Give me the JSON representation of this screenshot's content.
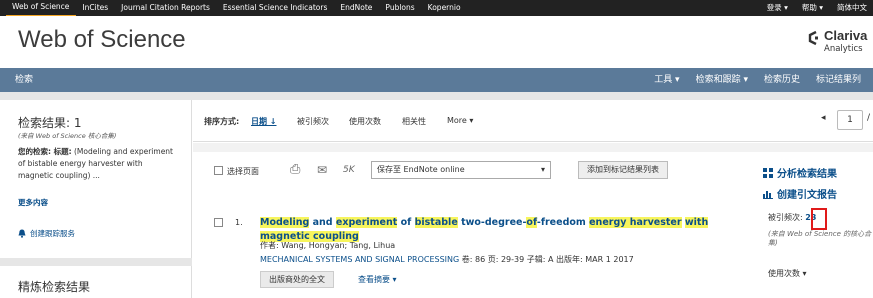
{
  "topnav": {
    "links": [
      "Web of Science",
      "InCites",
      "Journal Citation Reports",
      "Essential Science Indicators",
      "EndNote",
      "Publons",
      "Kopernio"
    ],
    "right": [
      "登录 ▾",
      "帮助 ▾",
      "简体中文"
    ]
  },
  "brand": {
    "title": "Web of Science",
    "company": "Clariva",
    "company_sub": "Analytics"
  },
  "searchbar": {
    "label": "检索",
    "menu": [
      "工具 ▾",
      "检索和跟踪 ▾",
      "检索历史",
      "标记结果列"
    ]
  },
  "left": {
    "results_title": "检索结果: 1",
    "results_source": "(来自 Web of Science 核心合集)",
    "query_label": "您的检索: 标题:",
    "query_text": "(Modeling and experiment of bistable energy harvester with magnetic coupling) ...",
    "more": "更多内容",
    "alert": "创建跟踪服务",
    "refine_title": "精炼检索结果"
  },
  "sort": {
    "label": "排序方式:",
    "options": [
      "日期 ↓",
      "被引频次",
      "使用次数",
      "相关性",
      "More ▾"
    ],
    "page_prev": "◂",
    "page_value": "1",
    "page_next": "/"
  },
  "tools": {
    "select_page": "选择页面",
    "print_icon": "⎙",
    "email_icon": "✉",
    "five_k": "5K",
    "save_option": "保存至 EndNote online",
    "add_marked": "添加到标记结果列表",
    "analyze": "分析检索结果",
    "citation_report": "创建引文报告"
  },
  "record": {
    "index": "1.",
    "title_segments": [
      {
        "text": "Modeling",
        "hl": true
      },
      {
        "text": " and ",
        "hl": false
      },
      {
        "text": "experiment",
        "hl": true
      },
      {
        "text": " of ",
        "hl": false
      },
      {
        "text": "bistable",
        "hl": true
      },
      {
        "text": " two-degree-",
        "hl": false
      },
      {
        "text": "of",
        "hl": true
      },
      {
        "text": "-freedom ",
        "hl": false
      },
      {
        "text": "energy harvester",
        "hl": true
      },
      {
        "text": " ",
        "hl": false
      },
      {
        "text": "with magnetic coupling",
        "hl": true
      }
    ],
    "authors": "作者: Wang, Hongyan; Tang, Lihua",
    "journal": "MECHANICAL SYSTEMS AND SIGNAL PROCESSING",
    "details": "卷: 86  页: 29-39  子辑: A  出版年: MAR 1 2017",
    "fulltext": "出版商处的全文",
    "abstract": "查看摘要 ▾",
    "cited_label": "被引频次:",
    "cited_count": "23",
    "cited_source": "(来自 Web of Science 的核心合集)",
    "usage": "使用次数 ▾"
  }
}
